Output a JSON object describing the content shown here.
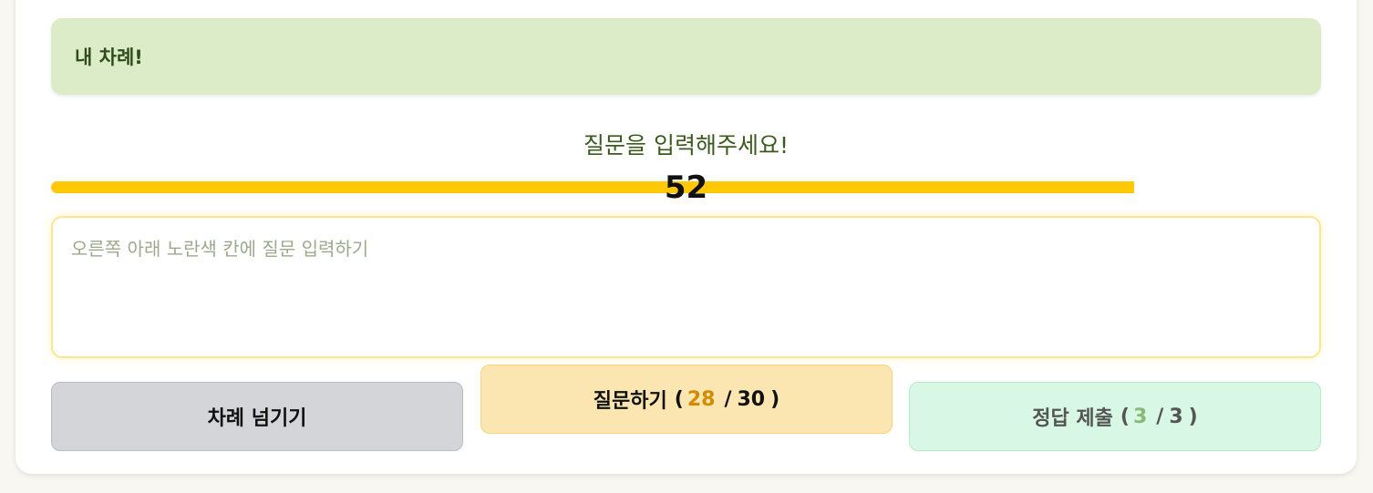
{
  "banner": {
    "text": "내 차례!"
  },
  "prompt": {
    "title": "질문을 입력해주세요!"
  },
  "timer": {
    "value": "52",
    "fraction": 0.853,
    "color": "#fec806"
  },
  "question_input": {
    "value": "",
    "placeholder": "오른쪽 아래 노란색 칸에 질문 입력하기"
  },
  "buttons": {
    "skip": {
      "label": "차례 넘기기"
    },
    "ask": {
      "label": "질문하기",
      "open": "(",
      "used": "28",
      "slash": "/",
      "total": "30",
      "close": ")"
    },
    "answer": {
      "label": "정답 제출",
      "open": "(",
      "used": "3",
      "slash": "/",
      "total": "3",
      "close": ")"
    }
  },
  "colors": {
    "banner_bg": "#dcebc8",
    "skip_bg": "#d4d5d8",
    "ask_bg": "#fbe6b1",
    "answer_bg": "#d8f7e4",
    "ask_count": "#d28a00",
    "answer_count": "#88b978"
  }
}
